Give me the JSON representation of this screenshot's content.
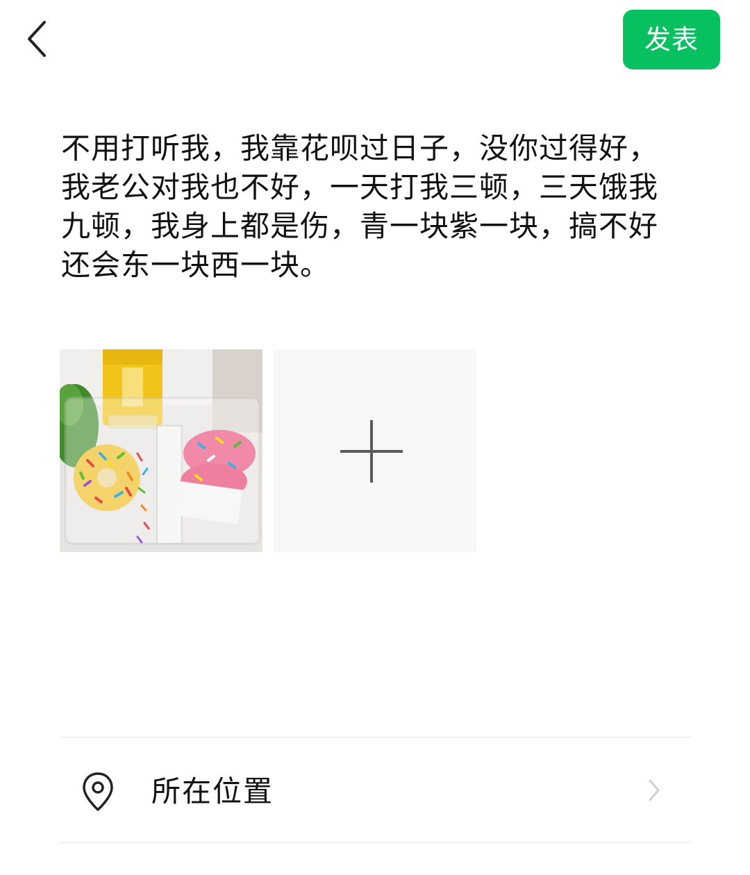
{
  "header": {
    "back_icon": "chevron-left-icon",
    "publish_label": "发表",
    "accent_color": "#07c160"
  },
  "post": {
    "text": "不用打听我，我靠花呗过日子，没你过得好，我老公对我也不好，一天打我三顿，三天饿我九顿，我身上都是伤，青一块紫一块，搞不好还会东一块西一块。"
  },
  "media": {
    "photos": [
      {
        "description_icon": "photo-thumbnail"
      }
    ],
    "add_icon": "plus-icon"
  },
  "options": {
    "location": {
      "icon": "location-pin-icon",
      "label": "所在位置",
      "arrow_icon": "chevron-right-icon"
    }
  }
}
